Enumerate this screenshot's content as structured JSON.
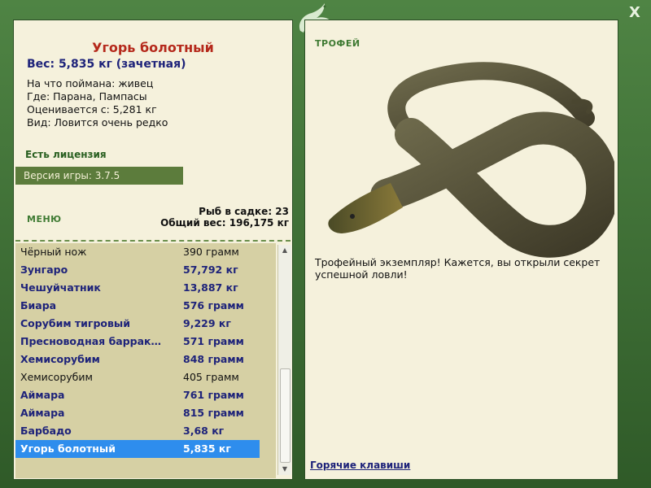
{
  "window": {
    "close_label": "X"
  },
  "fish": {
    "name": "Угорь болотный",
    "weight_line": "Вес: 5,835 кг (зачетная)",
    "caught_on": "На что поймана: живец",
    "where": "Где: Парана, Пампасы",
    "valued_from": "Оценивается с: 5,281 кг",
    "rarity": "Вид: Ловится очень редко"
  },
  "license_text": "Есть лицензия",
  "version_text": "Версия игры: 3.7.5",
  "menu_label": "МЕНЮ",
  "keepnet": {
    "count": "Рыб в садке: 23",
    "total": "Общий вес: 196,175 кг"
  },
  "catch_list": [
    {
      "name": "Чёрный нож",
      "weight": "390 грамм"
    },
    {
      "name": "Зунгаро",
      "weight": "57,792 кг"
    },
    {
      "name": "Чешуйчатник",
      "weight": "13,887 кг"
    },
    {
      "name": "Биара",
      "weight": "576 грамм"
    },
    {
      "name": "Сорубим тигровый",
      "weight": "9,229 кг"
    },
    {
      "name": "Пресноводная барраку...",
      "weight": "571 грамм"
    },
    {
      "name": "Хемисорубим",
      "weight": "848 грамм"
    },
    {
      "name": "Хемисорубим",
      "weight": "405 грамм"
    },
    {
      "name": "Аймара",
      "weight": "761 грамм"
    },
    {
      "name": "Аймара",
      "weight": "815 грамм"
    },
    {
      "name": "Барбадо",
      "weight": "3,68 кг"
    },
    {
      "name": "Угорь болотный",
      "weight": "5,835 кг"
    }
  ],
  "trophy_label": "ТРОФЕЙ",
  "trophy_text": "Трофейный экземпляр! Кажется, вы открыли секрет успешной ловли!",
  "hotkeys_label": "Горячие клавиши",
  "colors": {
    "frame": "#3b6a32",
    "panel": "#f5f1dc",
    "list_bg": "#d6d0a4",
    "selection": "#2e8ded",
    "title_red": "#b5291b",
    "bold_blue": "#1e237a"
  }
}
